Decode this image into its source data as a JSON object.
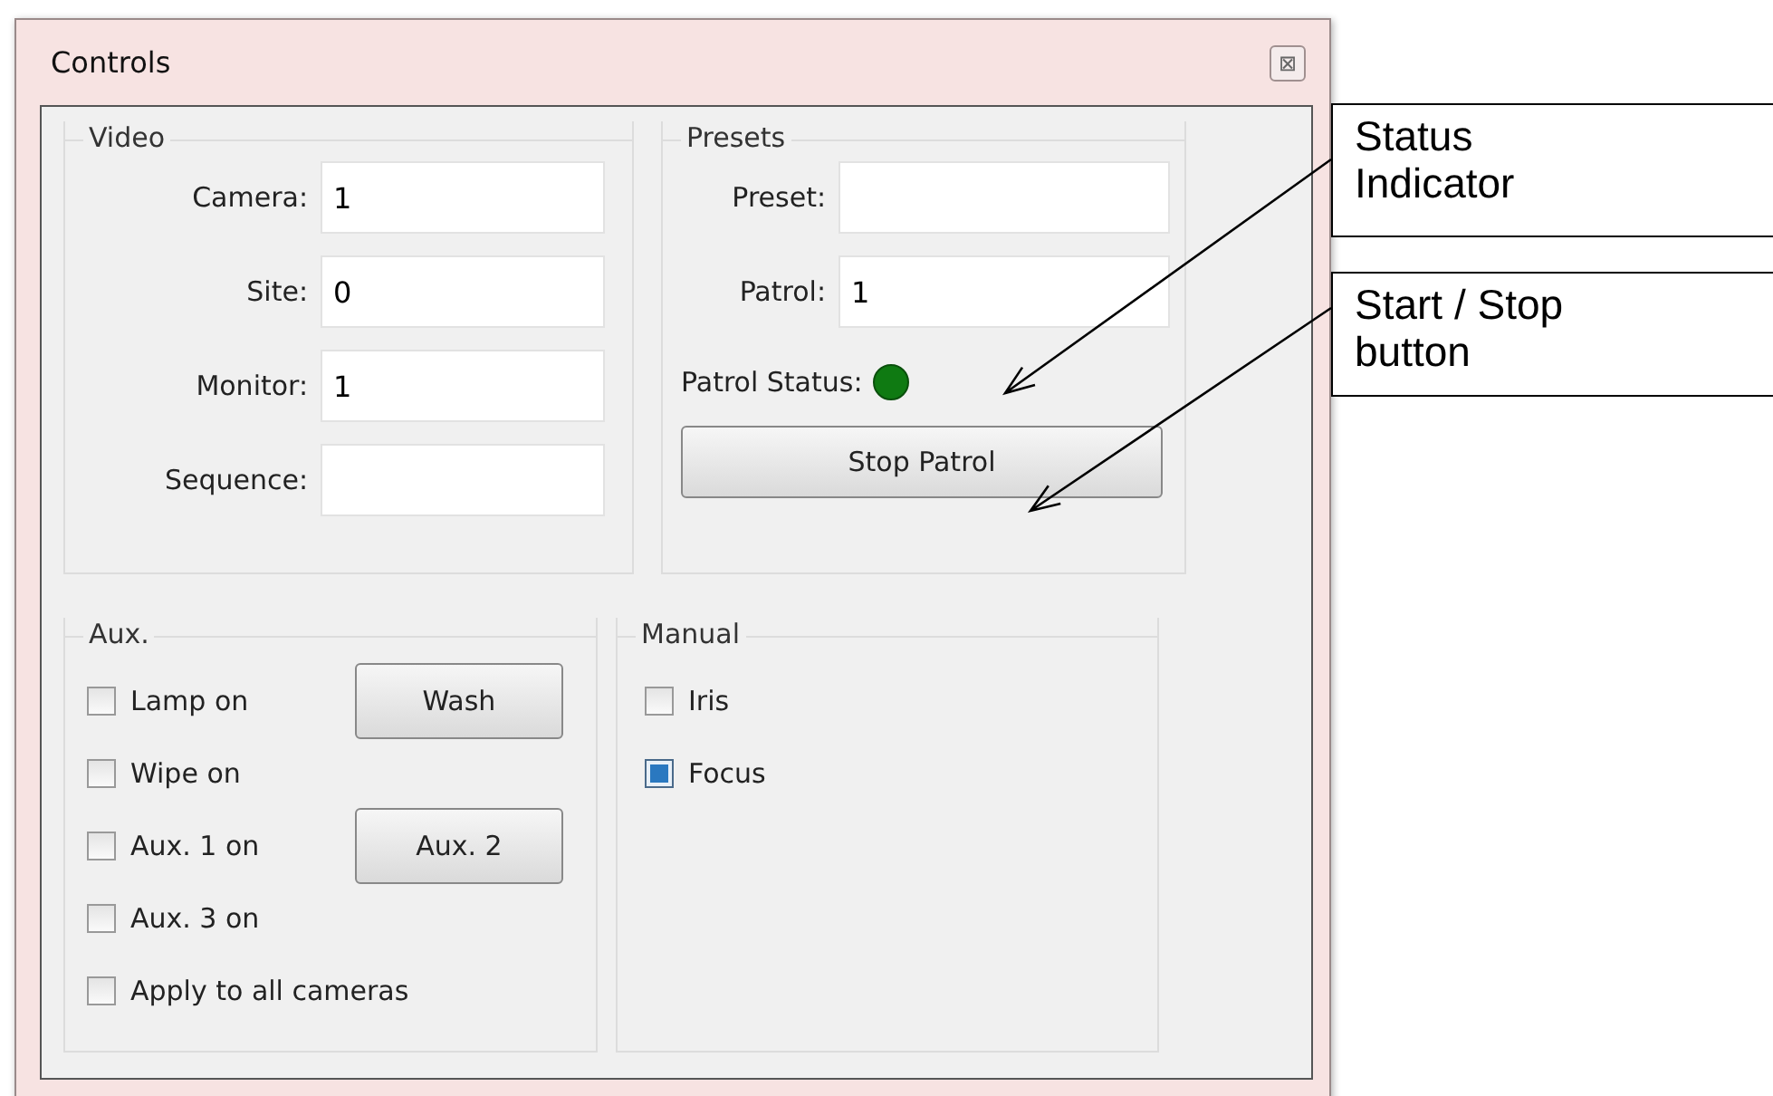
{
  "window": {
    "title": "Controls",
    "close": "⊠"
  },
  "video": {
    "title": "Video",
    "fields": [
      {
        "label": "Camera:",
        "value": "1"
      },
      {
        "label": "Site:",
        "value": "0"
      },
      {
        "label": "Monitor:",
        "value": "1"
      },
      {
        "label": "Sequence:"
      }
    ]
  },
  "presets": {
    "title": "Presets",
    "fields": [
      {
        "label": "Preset:"
      },
      {
        "label": "Patrol:",
        "value": "1"
      }
    ],
    "status": {
      "label": "Patrol Status:",
      "on": true
    },
    "button": "Stop Patrol"
  },
  "aux": {
    "title": "Aux.",
    "rows": [
      {
        "label": "Lamp on",
        "checked": false,
        "button": "Wash"
      },
      {
        "label": "Wipe on",
        "checked": false
      },
      {
        "label": "Aux. 1 on",
        "checked": false,
        "button": "Aux. 2"
      },
      {
        "label": "Aux. 3 on",
        "checked": false
      },
      {
        "label": "Apply to all cameras",
        "checked": false
      }
    ]
  },
  "manual": {
    "title": "Manual",
    "rows": [
      {
        "label": "Iris",
        "checked": false
      },
      {
        "label": "Focus",
        "checked": true
      }
    ]
  },
  "callouts": [
    {
      "text": "Status Indicator"
    },
    {
      "text": "Start / Stop button"
    }
  ]
}
